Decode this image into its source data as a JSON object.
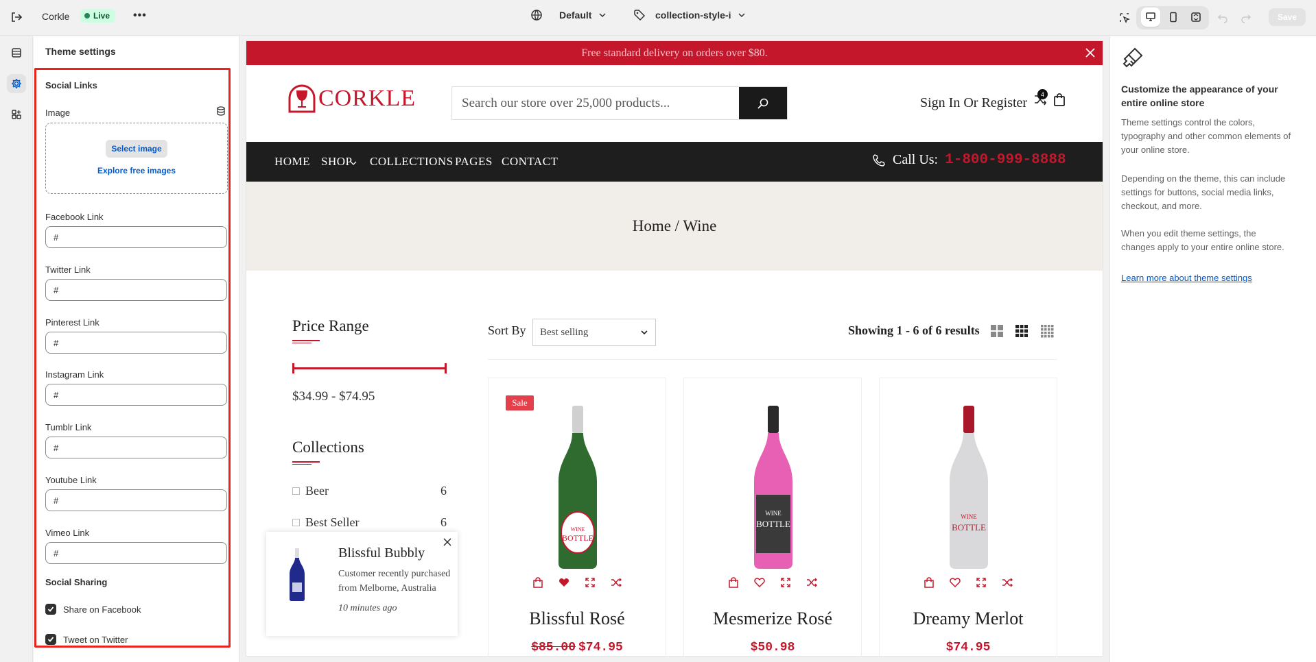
{
  "topbar": {
    "store_name": "Corkle",
    "status": "Live",
    "more": "•••",
    "theme_select": "Default",
    "template_select": "collection-style-i",
    "save_label": "Save"
  },
  "left_panel": {
    "title": "Theme settings",
    "section_social_links": "Social Links",
    "image_label": "Image",
    "select_image": "Select image",
    "explore_images": "Explore free images",
    "fields": [
      {
        "label": "Facebook Link",
        "value": "#"
      },
      {
        "label": "Twitter Link",
        "value": "#"
      },
      {
        "label": "Pinterest Link",
        "value": "#"
      },
      {
        "label": "Instagram Link",
        "value": "#"
      },
      {
        "label": "Tumblr Link",
        "value": "#"
      },
      {
        "label": "Youtube Link",
        "value": "#"
      },
      {
        "label": "Vimeo Link",
        "value": "#"
      }
    ],
    "section_social_sharing": "Social Sharing",
    "checkboxes": [
      {
        "label": "Share on Facebook",
        "checked": true
      },
      {
        "label": "Tweet on Twitter",
        "checked": true
      }
    ]
  },
  "store": {
    "announcement": "Free standard delivery on orders over $80.",
    "logo_text": "CORKLE",
    "search_placeholder": "Search our store over 25,000 products...",
    "account_text": "Sign In Or Register",
    "compare_count": "4",
    "nav": [
      "HOME",
      "SHOP",
      "COLLECTIONS",
      "PAGES",
      "CONTACT"
    ],
    "call_label": "Call Us:",
    "phone": "1-800-999-8888",
    "breadcrumb": "Home / Wine",
    "price_range_title": "Price Range",
    "price_range_value": "$34.99 - $74.95",
    "collections_title": "Collections",
    "collections": [
      {
        "name": "Beer",
        "count": "6"
      },
      {
        "name": "Best Seller",
        "count": "6"
      }
    ],
    "sort_label": "Sort By",
    "sort_value": "Best selling",
    "showing": "Showing 1 - 6 of 6 results",
    "products": [
      {
        "name": "Blissful Rosé",
        "old_price": "$85.00",
        "price": "$74.95",
        "sale": "Sale",
        "color": "#2f6b2f"
      },
      {
        "name": "Mesmerize Rosé",
        "old_price": "",
        "price": "$50.98",
        "sale": "",
        "color": "#e860b4"
      },
      {
        "name": "Dreamy Merlot",
        "old_price": "",
        "price": "$74.95",
        "sale": "",
        "color": "#d9d9dc"
      }
    ],
    "popup": {
      "title": "Blissful Bubbly",
      "desc": "Customer recently purchased from Melborne, Australia",
      "time": "10 minutes ago"
    }
  },
  "right_panel": {
    "heading": "Customize the appearance of your entire online store",
    "p1": "Theme settings control the colors, typography and other common elements of your online store.",
    "p2": "Depending on the theme, this can include settings for buttons, social media links, checkout, and more.",
    "p3": "When you edit theme settings, the changes apply to your entire online store.",
    "link": "Learn more about theme settings"
  }
}
